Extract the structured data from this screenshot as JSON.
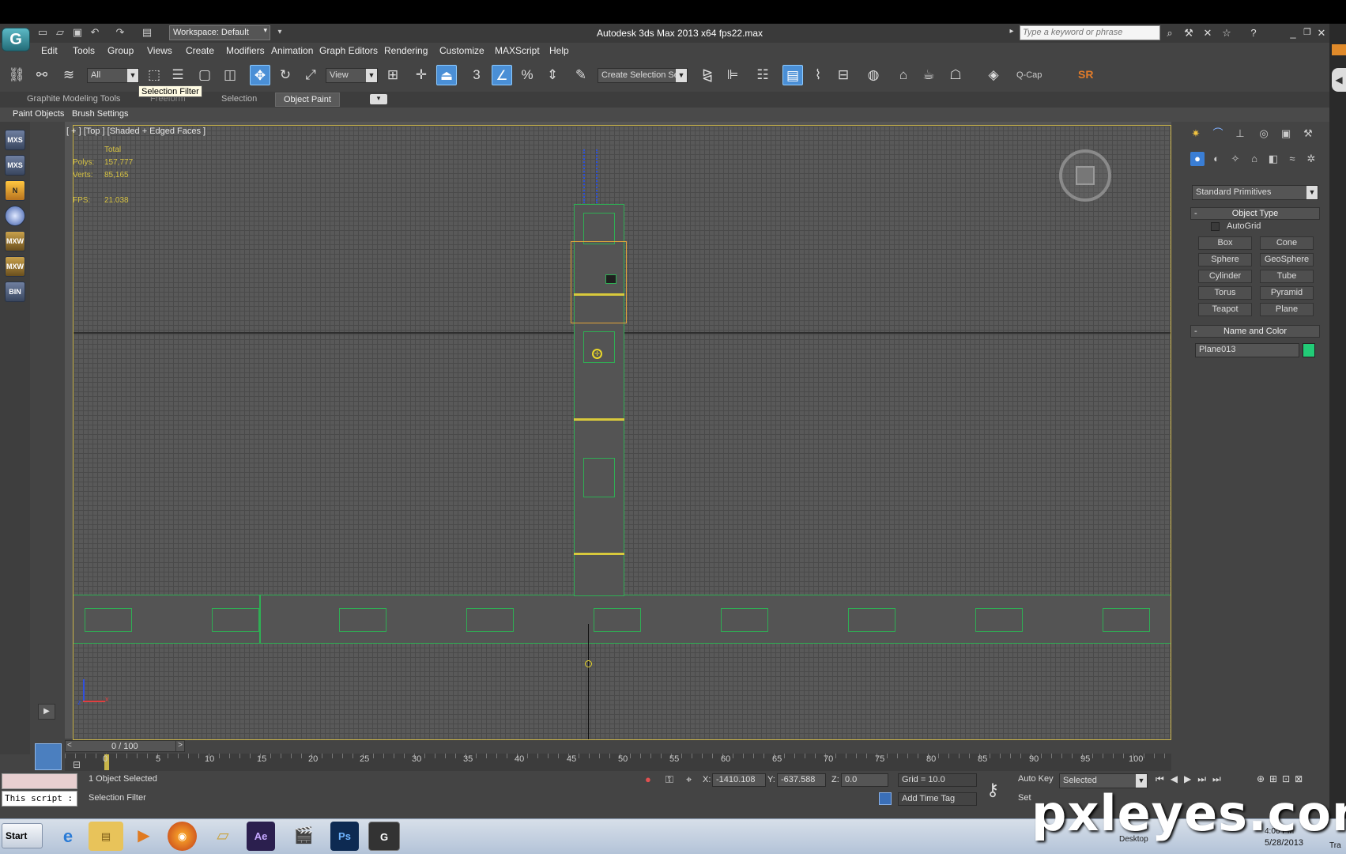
{
  "app": {
    "logo": "G",
    "workspace": "Workspace: Default",
    "title": "Autodesk 3ds Max  2013 x64     fps22.max",
    "search_placeholder": "Type a keyword or phrase"
  },
  "menu": [
    "Edit",
    "Tools",
    "Group",
    "Views",
    "Create",
    "Modifiers",
    "Animation",
    "Graph Editors",
    "Rendering",
    "Customize",
    "MAXScript",
    "Help"
  ],
  "toolbar": {
    "filter": "All",
    "view": "View",
    "snaps": [
      "3",
      "%"
    ],
    "selection_set": "Create Selection Se",
    "qcap": "Q-Cap",
    "sr": "SR",
    "tooltip": "Selection Filter"
  },
  "ribbon": {
    "tabs": [
      "Graphite Modeling Tools",
      "Freeform",
      "Selection",
      "Object Paint"
    ],
    "subtabs": [
      "Paint Objects",
      "Brush Settings"
    ]
  },
  "left_tools": [
    "MXS",
    "MXS",
    "N",
    "",
    "MXW",
    "MXW",
    "BIN"
  ],
  "viewport": {
    "label": "[ + ] [Top ] [Shaded + Edged Faces ]",
    "stats": {
      "total_label": "Total",
      "polys_label": "Polys:",
      "polys": "157,777",
      "verts_label": "Verts:",
      "verts": "85,165",
      "fps_label": "FPS:",
      "fps": "21.038"
    },
    "axis_x": "x",
    "axis_z": "z"
  },
  "command_panel": {
    "category": "Standard Primitives",
    "object_type_header": "Object Type",
    "autogrid": "AutoGrid",
    "buttons": [
      "Box",
      "Cone",
      "Sphere",
      "GeoSphere",
      "Cylinder",
      "Tube",
      "Torus",
      "Pyramid",
      "Teapot",
      "Plane"
    ],
    "name_color_header": "Name and Color",
    "name": "Plane013",
    "object_color": "#22cc77",
    "minus": "-"
  },
  "timeline": {
    "position": "0 / 100",
    "ticks": [
      "0",
      "5",
      "10",
      "15",
      "20",
      "25",
      "30",
      "35",
      "40",
      "45",
      "50",
      "55",
      "60",
      "65",
      "70",
      "75",
      "80",
      "85",
      "90",
      "95",
      "100"
    ]
  },
  "status": {
    "script": "This script :",
    "selected": "1 Object Selected",
    "prompt": "Selection Filter",
    "x_label": "X:",
    "x": "-1410.108",
    "y_label": "Y:",
    "y": "-637.588",
    "z_label": "Z:",
    "z": "0.0",
    "grid": "Grid = 10.0",
    "add_time_tag": "Add Time Tag",
    "auto_key": "Auto Key",
    "selected_mode": "Selected",
    "set_key": "Set"
  },
  "taskbar": {
    "start": "Start",
    "apps": [
      "IE",
      "Folder",
      "Media",
      "Firefox",
      "Files",
      "Ae",
      "Clapper",
      "Ps",
      "3ds"
    ],
    "clock_time": "4:06 PM",
    "clock_date": "5/28/2013",
    "desktop": "Desktop",
    "tray_tail": "Tra"
  },
  "watermark": "pxleyes.com"
}
